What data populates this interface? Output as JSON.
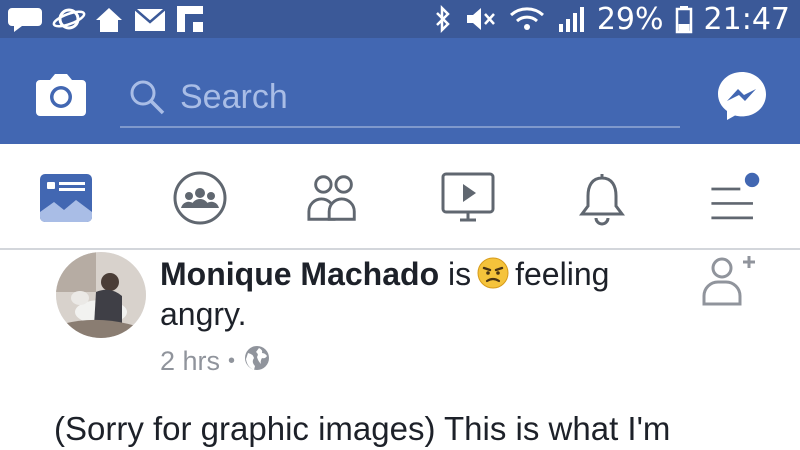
{
  "status_bar": {
    "battery": "29%",
    "time": "21:47",
    "left_icons": [
      "chat-notification-icon",
      "planet-icon",
      "home-icon",
      "mail-icon",
      "flipboard-icon"
    ],
    "right_icons": [
      "bluetooth-icon",
      "mute-icon",
      "wifi-icon",
      "signal-icon",
      "battery-icon"
    ]
  },
  "header": {
    "search_placeholder": "Search",
    "icons": [
      "camera-icon",
      "search-icon",
      "messenger-icon"
    ]
  },
  "tabs": [
    {
      "name": "news-feed",
      "icon": "news-feed-icon",
      "active": true
    },
    {
      "name": "groups",
      "icon": "groups-icon"
    },
    {
      "name": "friends",
      "icon": "friends-icon"
    },
    {
      "name": "watch",
      "icon": "watch-icon"
    },
    {
      "name": "notifications",
      "icon": "bell-icon"
    },
    {
      "name": "menu",
      "icon": "menu-icon",
      "badge_dot": true
    }
  ],
  "post": {
    "author": "Monique Machado",
    "is_text": "is",
    "feeling_pre": "feeling",
    "feeling": "angry.",
    "time_ago": "2 hrs",
    "separator": "•",
    "privacy_icon": "globe-icon",
    "text": "(Sorry for graphic images) This is what I'm"
  },
  "colors": {
    "status_bar": "#3b5998",
    "header": "#4267b2",
    "active_tab": "#4267b2",
    "badge": "#4267b2",
    "text": "#1d2129",
    "meta": "#90949c"
  }
}
